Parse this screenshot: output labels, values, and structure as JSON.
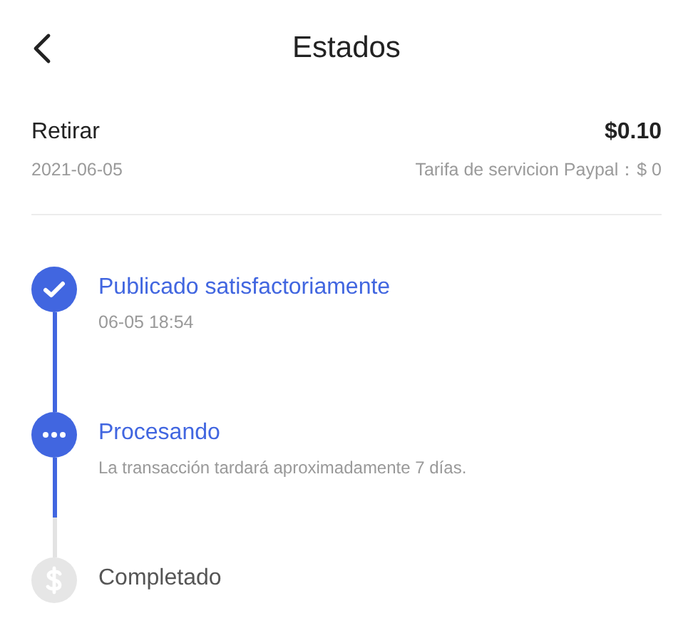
{
  "header": {
    "title": "Estados"
  },
  "summary": {
    "label": "Retirar",
    "amount": "$0.10",
    "date": "2021-06-05",
    "fee": "Tarifa de servicion Paypal：$ 0"
  },
  "steps": [
    {
      "kind": "done",
      "title": "Publicado satisfactoriamente",
      "detail": "06-05 18:54"
    },
    {
      "kind": "processing",
      "title": "Procesando",
      "detail": "La transacción tardará aproximadamente 7 días."
    },
    {
      "kind": "pending",
      "title": "Completado"
    }
  ]
}
